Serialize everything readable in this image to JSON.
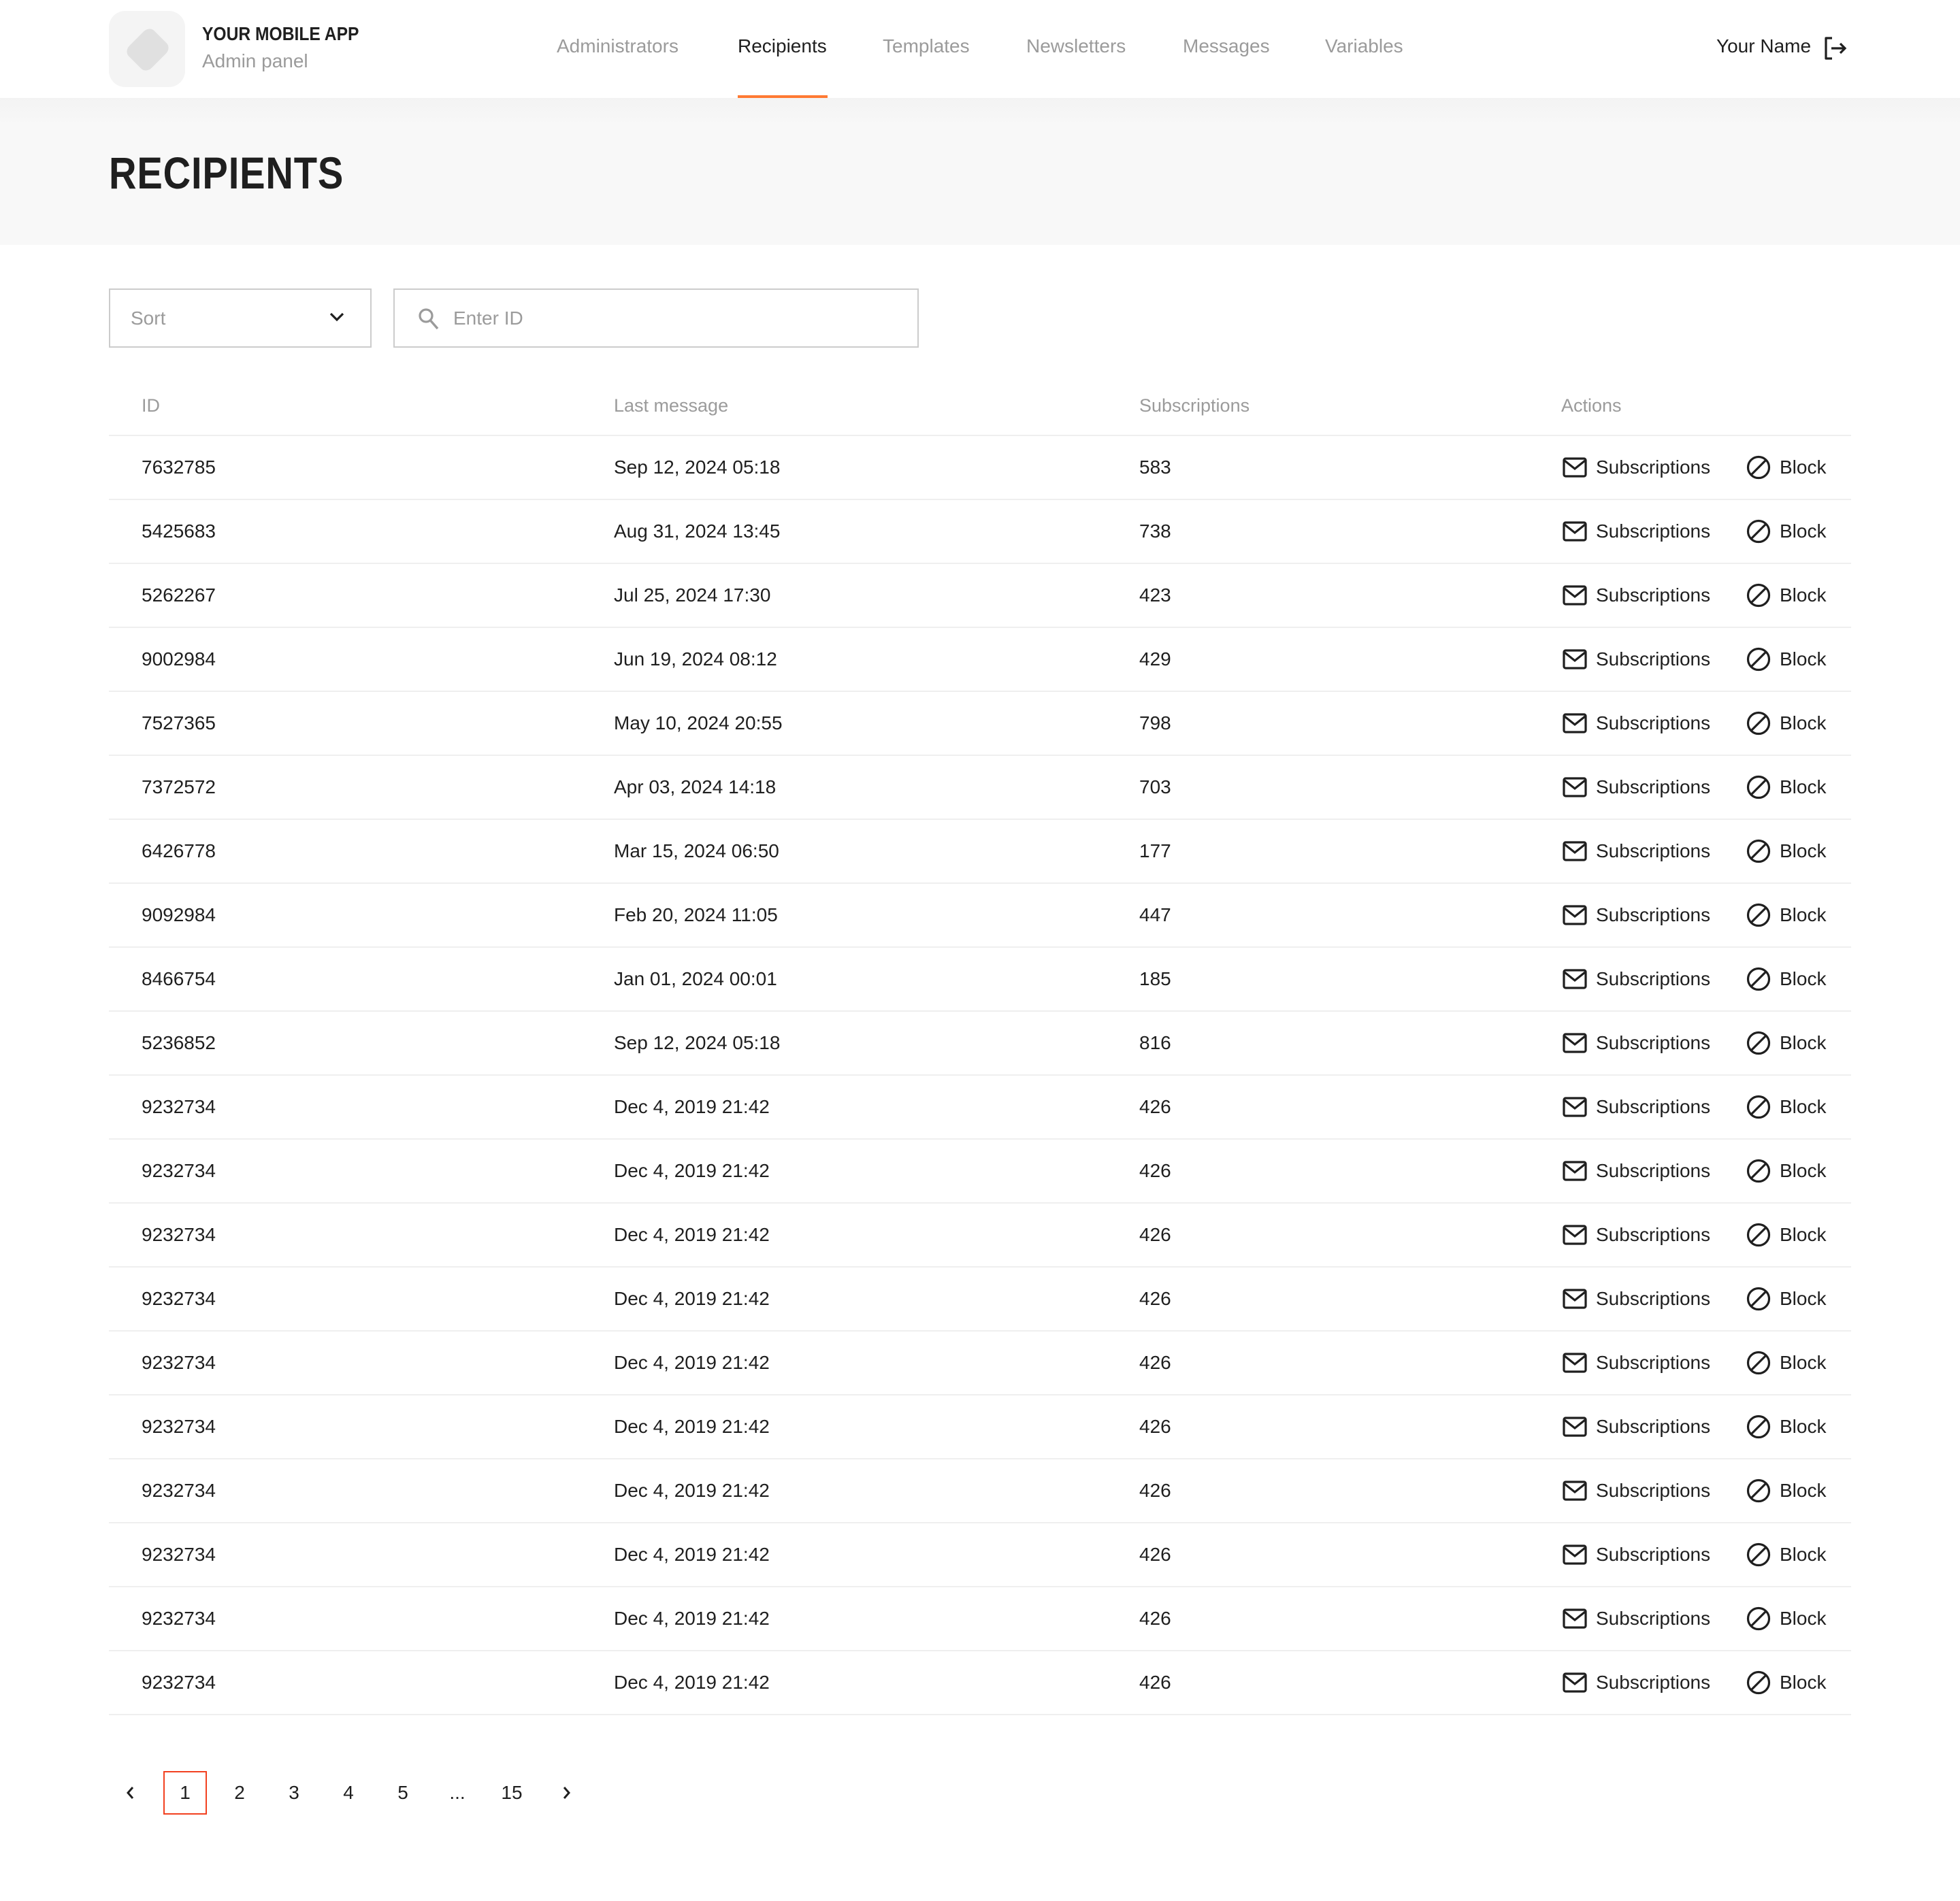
{
  "header": {
    "brand_title": "YOUR MOBILE APP",
    "brand_subtitle": "Admin panel",
    "nav": [
      {
        "label": "Administrators",
        "active": false
      },
      {
        "label": "Recipients",
        "active": true
      },
      {
        "label": "Templates",
        "active": false
      },
      {
        "label": "Newsletters",
        "active": false
      },
      {
        "label": "Messages",
        "active": false
      },
      {
        "label": "Variables",
        "active": false
      }
    ],
    "user_name": "Your Name",
    "logout_icon": "logout-icon"
  },
  "page": {
    "title": "RECIPIENTS"
  },
  "filters": {
    "sort_label": "Sort",
    "search_placeholder": "Enter ID",
    "search_value": ""
  },
  "table": {
    "columns": [
      "ID",
      "Last message",
      "Subscriptions",
      "Actions"
    ],
    "action_labels": {
      "subscriptions": "Subscriptions",
      "block": "Block"
    },
    "rows": [
      {
        "id": "7632785",
        "last_message": "Sep 12, 2024 05:18",
        "subscriptions": "583"
      },
      {
        "id": "5425683",
        "last_message": "Aug 31, 2024 13:45",
        "subscriptions": "738"
      },
      {
        "id": "5262267",
        "last_message": "Jul 25, 2024 17:30",
        "subscriptions": "423"
      },
      {
        "id": "9002984",
        "last_message": "Jun 19, 2024 08:12",
        "subscriptions": "429"
      },
      {
        "id": "7527365",
        "last_message": "May 10, 2024 20:55",
        "subscriptions": "798"
      },
      {
        "id": "7372572",
        "last_message": "Apr 03, 2024 14:18",
        "subscriptions": "703"
      },
      {
        "id": "6426778",
        "last_message": "Mar 15, 2024 06:50",
        "subscriptions": "177"
      },
      {
        "id": "9092984",
        "last_message": "Feb 20, 2024 11:05",
        "subscriptions": "447"
      },
      {
        "id": "8466754",
        "last_message": "Jan 01, 2024 00:01",
        "subscriptions": "185"
      },
      {
        "id": "5236852",
        "last_message": "Sep 12, 2024 05:18",
        "subscriptions": "816"
      },
      {
        "id": "9232734",
        "last_message": "Dec 4, 2019 21:42",
        "subscriptions": "426"
      },
      {
        "id": "9232734",
        "last_message": "Dec 4, 2019 21:42",
        "subscriptions": "426"
      },
      {
        "id": "9232734",
        "last_message": "Dec 4, 2019 21:42",
        "subscriptions": "426"
      },
      {
        "id": "9232734",
        "last_message": "Dec 4, 2019 21:42",
        "subscriptions": "426"
      },
      {
        "id": "9232734",
        "last_message": "Dec 4, 2019 21:42",
        "subscriptions": "426"
      },
      {
        "id": "9232734",
        "last_message": "Dec 4, 2019 21:42",
        "subscriptions": "426"
      },
      {
        "id": "9232734",
        "last_message": "Dec 4, 2019 21:42",
        "subscriptions": "426"
      },
      {
        "id": "9232734",
        "last_message": "Dec 4, 2019 21:42",
        "subscriptions": "426"
      },
      {
        "id": "9232734",
        "last_message": "Dec 4, 2019 21:42",
        "subscriptions": "426"
      },
      {
        "id": "9232734",
        "last_message": "Dec 4, 2019 21:42",
        "subscriptions": "426"
      }
    ]
  },
  "pagination": {
    "pages": [
      "1",
      "2",
      "3",
      "4",
      "5",
      "...",
      "15"
    ],
    "current": "1"
  },
  "colors": {
    "accent": "#ff7a33",
    "current_page_border": "#f2401f",
    "muted_text": "#9b9b9b",
    "text": "#1f1f1f"
  }
}
